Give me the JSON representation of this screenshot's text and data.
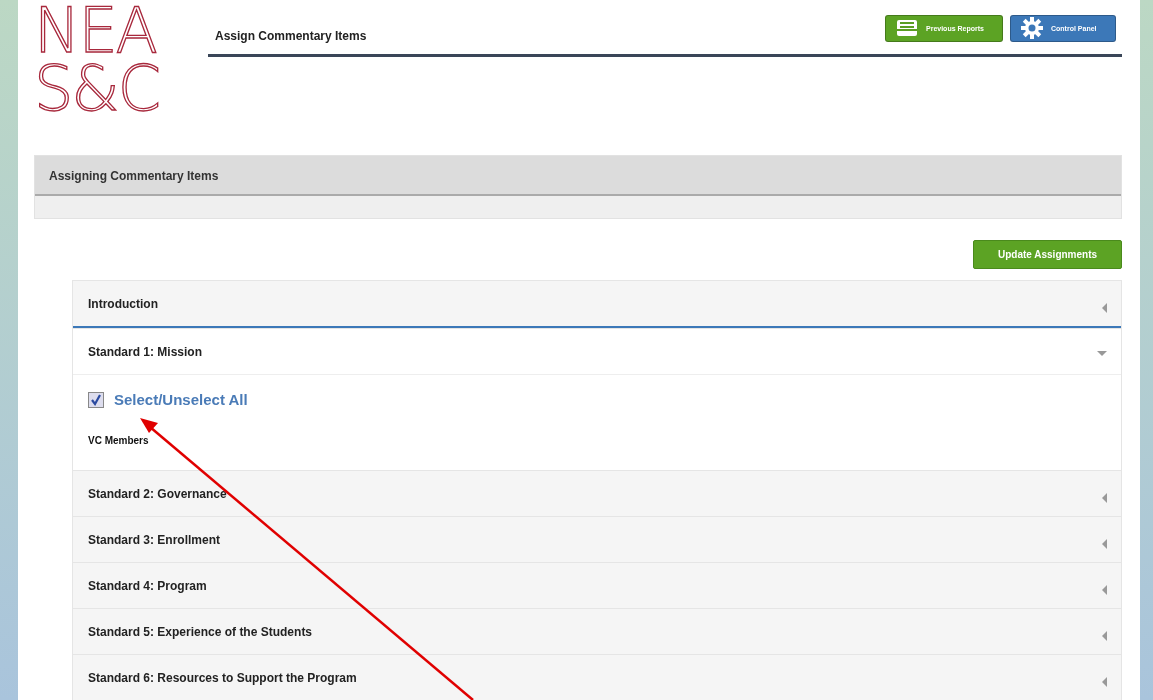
{
  "logo": {
    "lines": [
      "NEA",
      "S&C"
    ]
  },
  "header": {
    "title": "Assign Commentary Items",
    "buttons": [
      {
        "label": "Previous Reports",
        "kind": "reports"
      },
      {
        "label": "Control Panel",
        "kind": "settings"
      }
    ]
  },
  "panel": {
    "title": "Assigning Commentary Items"
  },
  "update_button": "Update Assignments",
  "sections": [
    {
      "title": "Introduction",
      "expanded": false
    },
    {
      "title": "Standard 1: Mission",
      "expanded": true,
      "select_all": {
        "label": "Select/Unselect All",
        "checked": true
      },
      "group_label": "VC Members"
    },
    {
      "title": "Standard 2: Governance",
      "expanded": false
    },
    {
      "title": "Standard 3: Enrollment",
      "expanded": false
    },
    {
      "title": "Standard 4: Program",
      "expanded": false
    },
    {
      "title": "Standard 5: Experience of the Students",
      "expanded": false
    },
    {
      "title": "Standard 6: Resources to Support the Program",
      "expanded": false
    }
  ],
  "annotation": {
    "kind": "arrow"
  }
}
